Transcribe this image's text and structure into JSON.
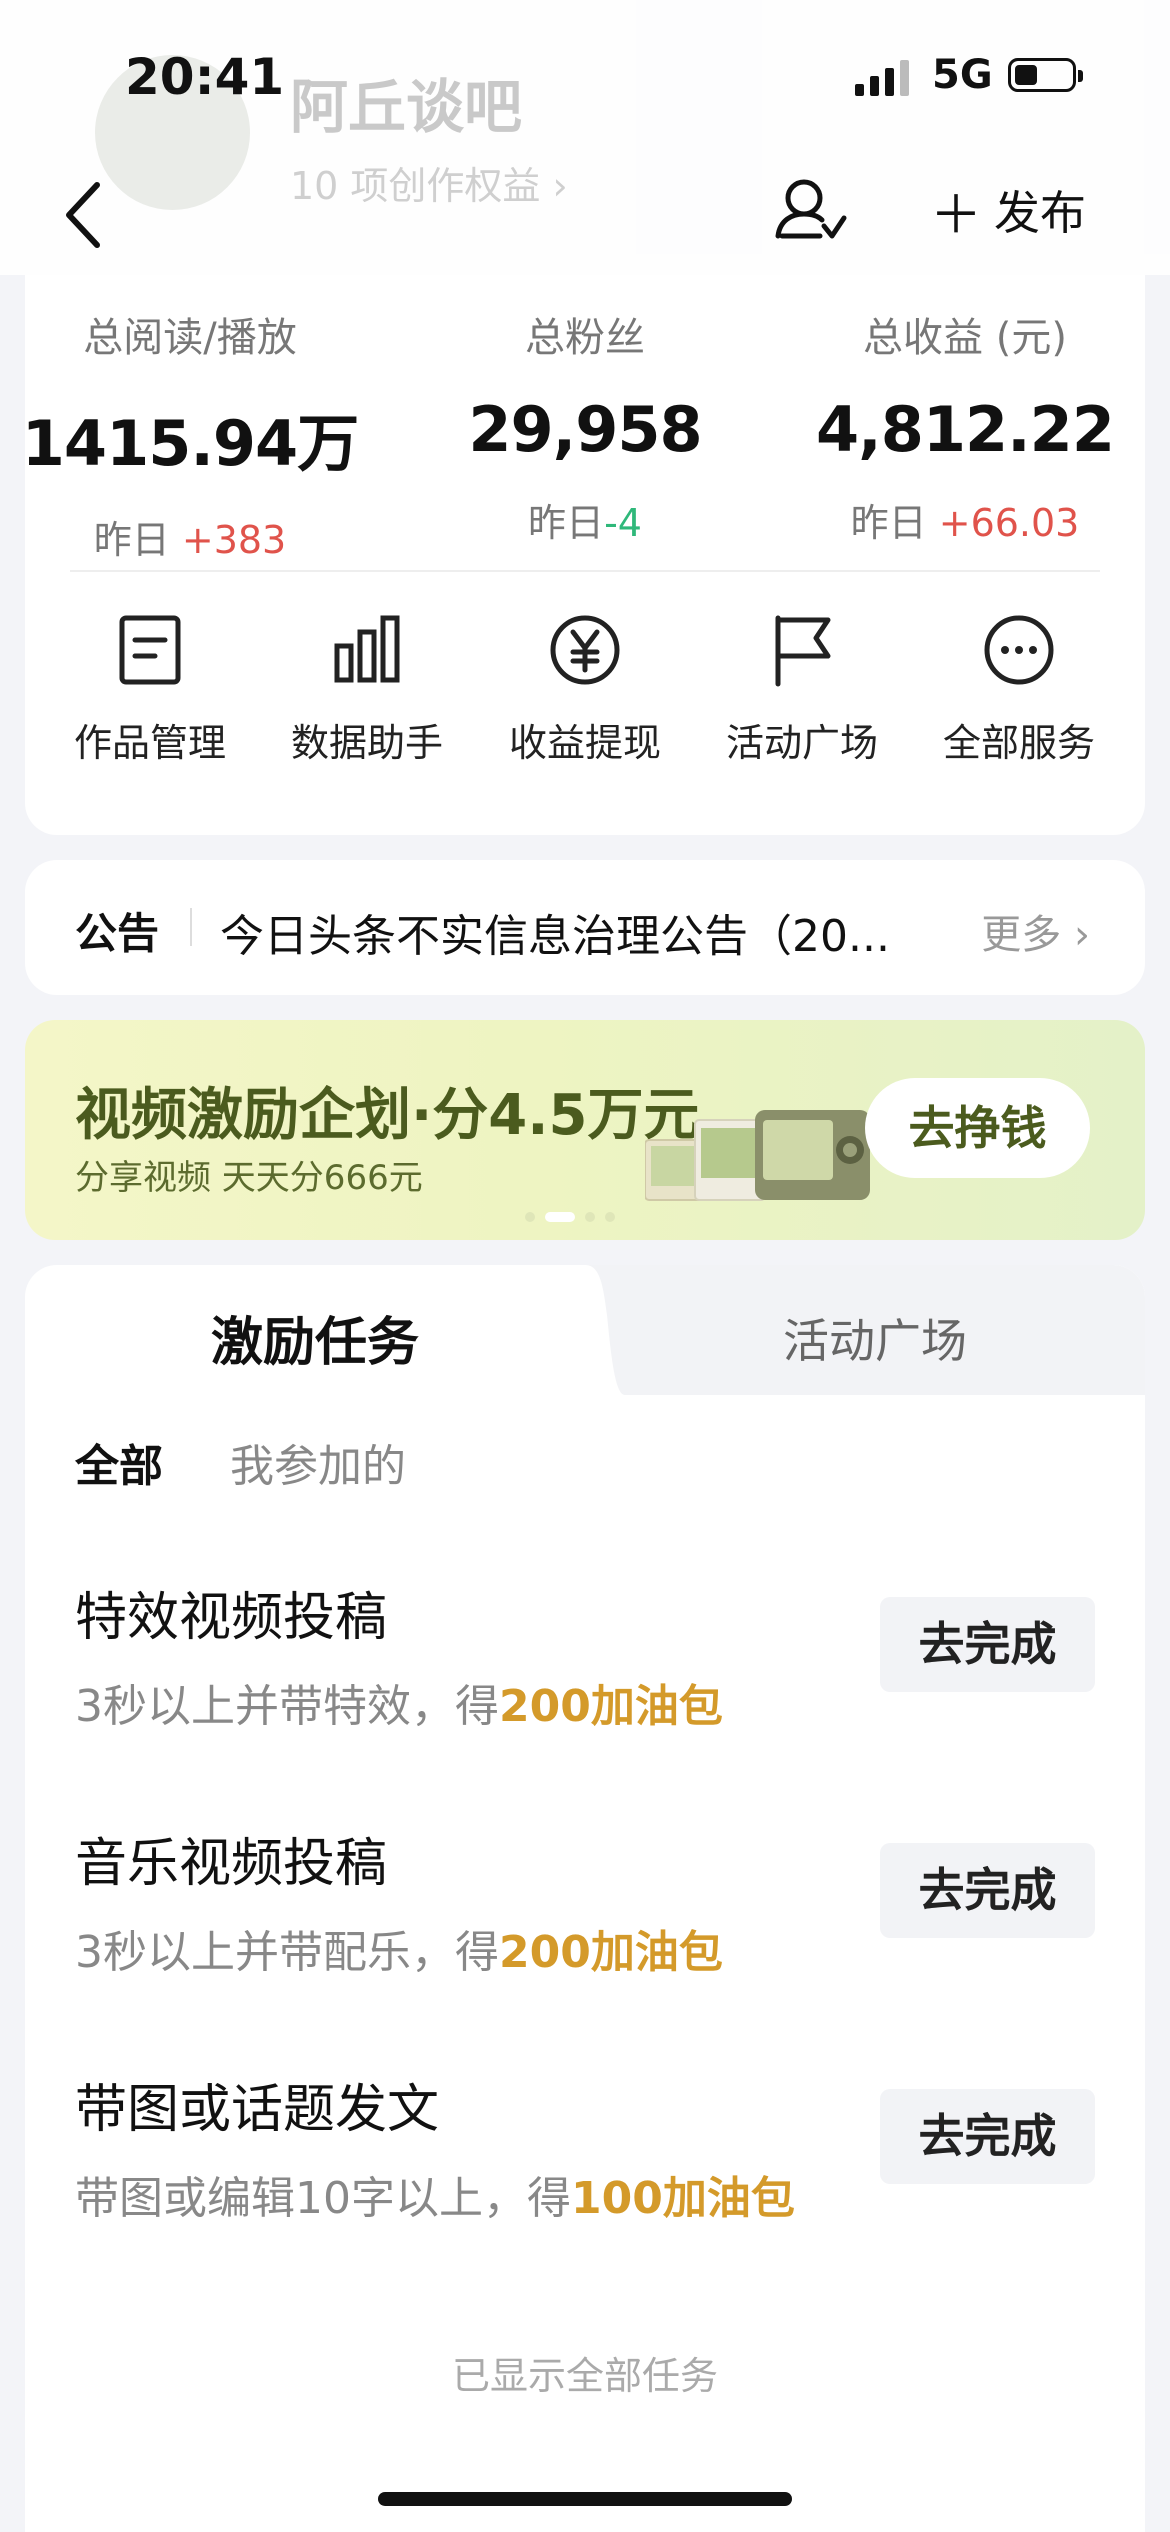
{
  "status_bar": {
    "time": "20:41",
    "network": "5G"
  },
  "header": {
    "username": "阿丘谈吧",
    "rights": "10 项创作权益 ›",
    "publish_label": "发布"
  },
  "stats": [
    {
      "label": "总阅读/播放",
      "value": "1415.94万",
      "delta_prefix": "昨日",
      "delta": "+383",
      "trend": "up"
    },
    {
      "label": "总粉丝",
      "value": "29,958",
      "delta_prefix": "昨日",
      "delta": "-4",
      "trend": "down"
    },
    {
      "label": "总收益 (元)",
      "value": "4,812.22",
      "delta_prefix": "昨日",
      "delta": "+66.03",
      "trend": "up"
    }
  ],
  "services": [
    {
      "label": "作品管理",
      "icon": "document-icon"
    },
    {
      "label": "数据助手",
      "icon": "bar-chart-icon"
    },
    {
      "label": "收益提现",
      "icon": "yuan-icon"
    },
    {
      "label": "活动广场",
      "icon": "flag-icon"
    },
    {
      "label": "全部服务",
      "icon": "more-icon"
    }
  ],
  "notice": {
    "tag": "公告",
    "text": "今日头条不实信息治理公告（20...",
    "more": "更多 ›"
  },
  "banner": {
    "title": "视频激励企划·分4.5万元",
    "subtitle": "分享视频 天天分666元",
    "cta": "去挣钱",
    "page_count": 4,
    "active_page": 1
  },
  "tasks": {
    "tabs": [
      "激励任务",
      "活动广场"
    ],
    "filters": [
      "全部",
      "我参加的"
    ],
    "items": [
      {
        "name": "特效视频投稿",
        "desc": "3秒以上并带特效，得",
        "reward": "200加油包",
        "button": "去完成"
      },
      {
        "name": "音乐视频投稿",
        "desc": "3秒以上并带配乐，得",
        "reward": "200加油包",
        "button": "去完成"
      },
      {
        "name": "带图或话题发文",
        "desc": "带图或编辑10字以上，得",
        "reward": "100加油包",
        "button": "去完成"
      }
    ],
    "footer": "已显示全部任务"
  },
  "colors": {
    "up": "#e0534b",
    "down": "#2fb87a",
    "reward": "#d49a2a"
  }
}
